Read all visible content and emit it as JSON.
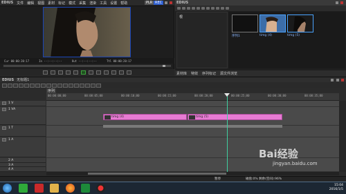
{
  "player": {
    "app_name": "EDIUS",
    "menu": [
      "文件",
      "编辑",
      "视图",
      "素材",
      "标记",
      "模式",
      "采集",
      "渲染",
      "工具",
      "设置",
      "帮助"
    ],
    "mode_badge": "PLR",
    "rec_badge": "REC",
    "timecodes": {
      "cur": "Cur 00:00:20:17",
      "in": "In --:--:--:--",
      "out": "Out --:--:--:--",
      "ttl": "Ttl 00:00:20:17"
    }
  },
  "bin": {
    "title": "EDIUS",
    "folder_label": "根",
    "clips": [
      {
        "caption": "序列1",
        "selected": false
      },
      {
        "caption": "timg (4)",
        "selected": true
      },
      {
        "caption": "timg (5)",
        "selected": true
      }
    ],
    "tabs": [
      "素材库",
      "特效",
      "序列标记",
      "源文件浏览"
    ]
  },
  "timeline": {
    "app_name": "EDIUS",
    "sequence_name": "无标题1",
    "tab_label": "序列1",
    "ruler_ticks": [
      "00:00:00;00",
      "00:00:05;00",
      "00:00:10;00",
      "00:00:15;00",
      "00:00:20;00",
      "00:00:25;00",
      "00:00:30;00",
      "00:00:35;00"
    ],
    "tracks": [
      {
        "name": "1 V"
      },
      {
        "name": "1 VA"
      },
      {
        "name": "1 T"
      },
      {
        "name": "1 A"
      },
      {
        "name": "2 A"
      },
      {
        "name": "3 A"
      },
      {
        "name": "4 A"
      }
    ],
    "clips": [
      {
        "label": "timg (4)"
      },
      {
        "label": "timg (5)"
      }
    ],
    "status": {
      "left": "暂停",
      "disk": "磁盘:0% 剩余(空间):96%"
    }
  },
  "taskbar": {
    "time": "15:04",
    "date": "2016/1/5"
  },
  "watermark": {
    "brand": "Bai经验",
    "url": "jingyan.baidu.com"
  },
  "colors": {
    "clip": "#e77bd3",
    "playhead": "#3fd0a0",
    "accent": "#1a45b8"
  }
}
